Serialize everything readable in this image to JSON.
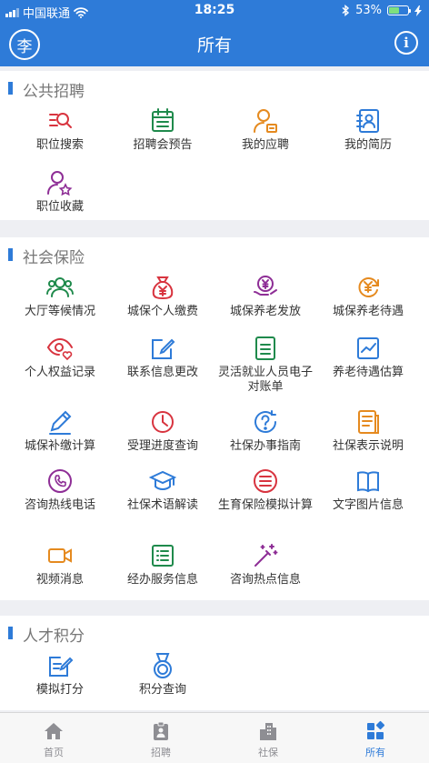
{
  "status_bar": {
    "carrier": "中国联通",
    "time": "18:25",
    "battery": "53%"
  },
  "nav": {
    "avatar_char": "李",
    "title": "所有",
    "info_glyph": "i"
  },
  "sections": [
    {
      "title": "公共招聘",
      "items": [
        {
          "label": "职位搜索",
          "icon": "job-search-icon",
          "color": "#d8343f"
        },
        {
          "label": "招聘会预告",
          "icon": "calendar-icon",
          "color": "#1f8a4c"
        },
        {
          "label": "我的应聘",
          "icon": "user-application-icon",
          "color": "#e58a1f"
        },
        {
          "label": "我的简历",
          "icon": "resume-icon",
          "color": "#2e7bd8"
        },
        {
          "label": "职位收藏",
          "icon": "user-star-icon",
          "color": "#8e2e96"
        }
      ]
    },
    {
      "title": "社会保险",
      "items": [
        {
          "label": "大厅等候情况",
          "icon": "people-icon",
          "color": "#1f8a4c"
        },
        {
          "label": "城保个人缴费",
          "icon": "money-bag-icon",
          "color": "#d8343f"
        },
        {
          "label": "城保养老发放",
          "icon": "yuan-hand-icon",
          "color": "#8e2e96"
        },
        {
          "label": "城保养老待遇",
          "icon": "yuan-cycle-icon",
          "color": "#e58a1f"
        },
        {
          "label": "个人权益记录",
          "icon": "eye-heart-icon",
          "color": "#d8343f"
        },
        {
          "label": "联系信息更改",
          "icon": "edit-square-icon",
          "color": "#2e7bd8"
        },
        {
          "label": "灵活就业人员电子对账单",
          "icon": "document-icon",
          "color": "#1f8a4c"
        },
        {
          "label": "养老待遇估算",
          "icon": "line-chart-icon",
          "color": "#2e7bd8"
        },
        {
          "label": "城保补缴计算",
          "icon": "pencil-icon",
          "color": "#2e7bd8"
        },
        {
          "label": "受理进度查询",
          "icon": "clock-icon",
          "color": "#d8343f"
        },
        {
          "label": "社保办事指南",
          "icon": "help-circle-icon",
          "color": "#2e7bd8"
        },
        {
          "label": "社保表示说明",
          "icon": "notes-icon",
          "color": "#e58a1f"
        },
        {
          "label": "咨询热线电话",
          "icon": "phone-icon",
          "color": "#8e2e96"
        },
        {
          "label": "社保术语解读",
          "icon": "graduation-cap-icon",
          "color": "#2e7bd8"
        },
        {
          "label": "生育保险模拟计算",
          "icon": "list-circle-icon",
          "color": "#d8343f"
        },
        {
          "label": "文字图片信息",
          "icon": "open-book-icon",
          "color": "#2e7bd8"
        },
        {
          "label": "视频消息",
          "icon": "video-icon",
          "color": "#e58a1f"
        },
        {
          "label": "经办服务信息",
          "icon": "list-square-icon",
          "color": "#1f8a4c"
        },
        {
          "label": "咨询热点信息",
          "icon": "magic-wand-icon",
          "color": "#8e2e96"
        }
      ]
    },
    {
      "title": "人才积分",
      "items": [
        {
          "label": "模拟打分",
          "icon": "score-edit-icon",
          "color": "#2e7bd8"
        },
        {
          "label": "积分查询",
          "icon": "medal-icon",
          "color": "#2e7bd8"
        }
      ]
    }
  ],
  "tabs": [
    {
      "label": "首页",
      "icon": "home-icon"
    },
    {
      "label": "招聘",
      "icon": "badge-icon"
    },
    {
      "label": "社保",
      "icon": "building-icon"
    },
    {
      "label": "所有",
      "icon": "grid-icon",
      "active": true
    }
  ],
  "colors": {
    "primary": "#2e7bd8",
    "background": "#eeeff3"
  }
}
